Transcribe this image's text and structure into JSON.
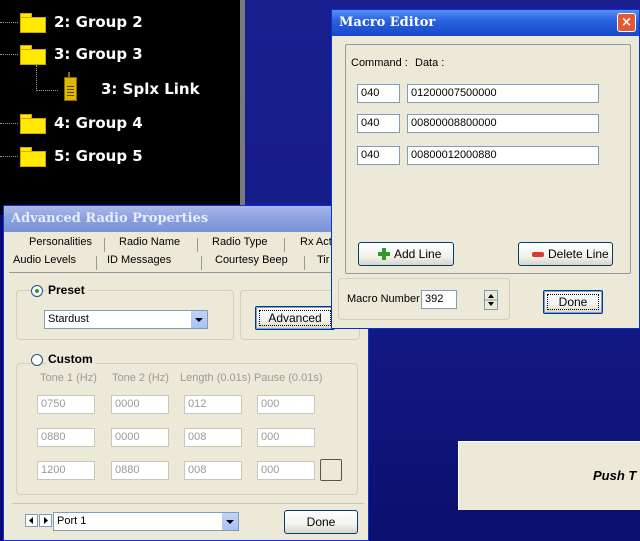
{
  "tree": {
    "items": [
      {
        "label": "2: Group 2"
      },
      {
        "label": "3: Group 3"
      },
      {
        "label": "3: Splx Link"
      },
      {
        "label": "4: Group 4"
      },
      {
        "label": "5: Group 5"
      }
    ]
  },
  "background_panel": {
    "push_text": "Push T"
  },
  "advanced": {
    "title": "Advanced Radio Properties",
    "tabs_row1": [
      "Personalities",
      "Radio Name",
      "Radio Type",
      "Rx Act"
    ],
    "tabs_row2": [
      "Audio Levels",
      "ID Messages",
      "Courtesy Beep",
      "Tir"
    ],
    "preset": {
      "label": "Preset",
      "selected_value": "Stardust",
      "advanced_button": "Advanced"
    },
    "custom": {
      "label": "Custom",
      "headers": [
        "Tone 1 (Hz)",
        "Tone 2 (Hz)",
        "Length (0.01s)",
        "Pause (0.01s)"
      ],
      "rows": [
        [
          "0750",
          "0000",
          "012",
          "000"
        ],
        [
          "0880",
          "0000",
          "008",
          "000"
        ],
        [
          "1200",
          "0880",
          "008",
          "000"
        ]
      ]
    },
    "port": {
      "selected_value": "Port 1"
    },
    "done_button": "Done"
  },
  "macro": {
    "title": "Macro Editor",
    "command_header": "Command :",
    "data_header": "Data :",
    "rows": [
      {
        "command": "040",
        "data": "01200007500000"
      },
      {
        "command": "040",
        "data": "00800008800000"
      },
      {
        "command": "040",
        "data": "00800012000880"
      }
    ],
    "add_line_button": "Add Line",
    "delete_line_button": "Delete Line",
    "macro_number_label": "Macro Number :",
    "macro_number_value": "392",
    "done_button": "Done",
    "close_glyph": "×"
  },
  "colors": {
    "titlebar": "#2763e0",
    "window_bg": "#ece9d8",
    "tree_bg": "#000000",
    "folder": "#ffea00",
    "desktop": "#141a86"
  }
}
